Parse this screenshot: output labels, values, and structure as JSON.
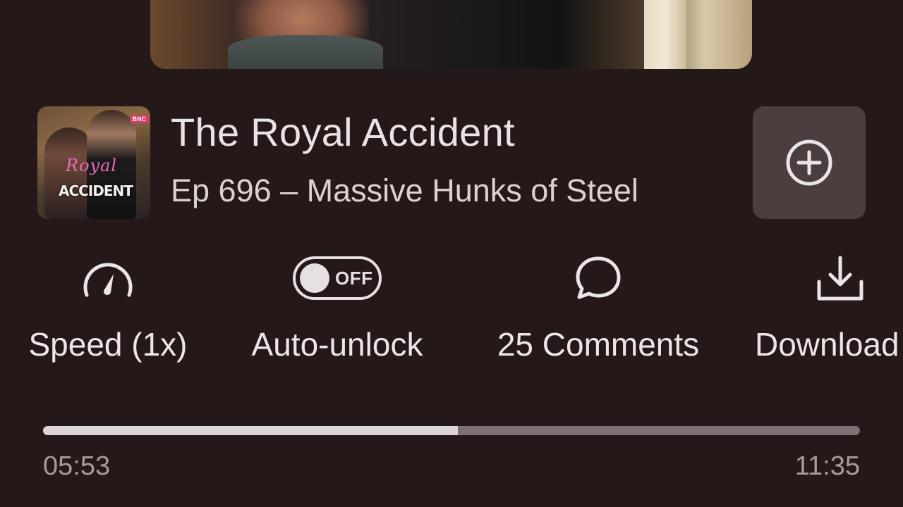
{
  "header": {
    "series_title": "The Royal Accident",
    "episode_title": "Ep 696 – Massive Hunks of Steel",
    "thumbnail": {
      "script_text": "Royal",
      "block_text": "ACCIDENT",
      "badge": "BNC"
    },
    "add_icon": "plus-circle-icon"
  },
  "actions": {
    "speed": {
      "label": "Speed (1x)",
      "icon": "speedometer-icon"
    },
    "auto_unlock": {
      "label": "Auto-unlock",
      "state": "OFF",
      "icon": "toggle-icon"
    },
    "comments": {
      "label": "25 Comments",
      "icon": "speech-bubble-icon"
    },
    "download": {
      "label": "Download",
      "icon": "download-icon"
    }
  },
  "player": {
    "elapsed": "05:53",
    "total": "11:35",
    "progress_fraction": 0.508
  },
  "colors": {
    "background": "#241819",
    "add_button_bg": "#4a3e3f",
    "progress_played": "#dcd7d6",
    "progress_remaining": "#7c7072"
  }
}
